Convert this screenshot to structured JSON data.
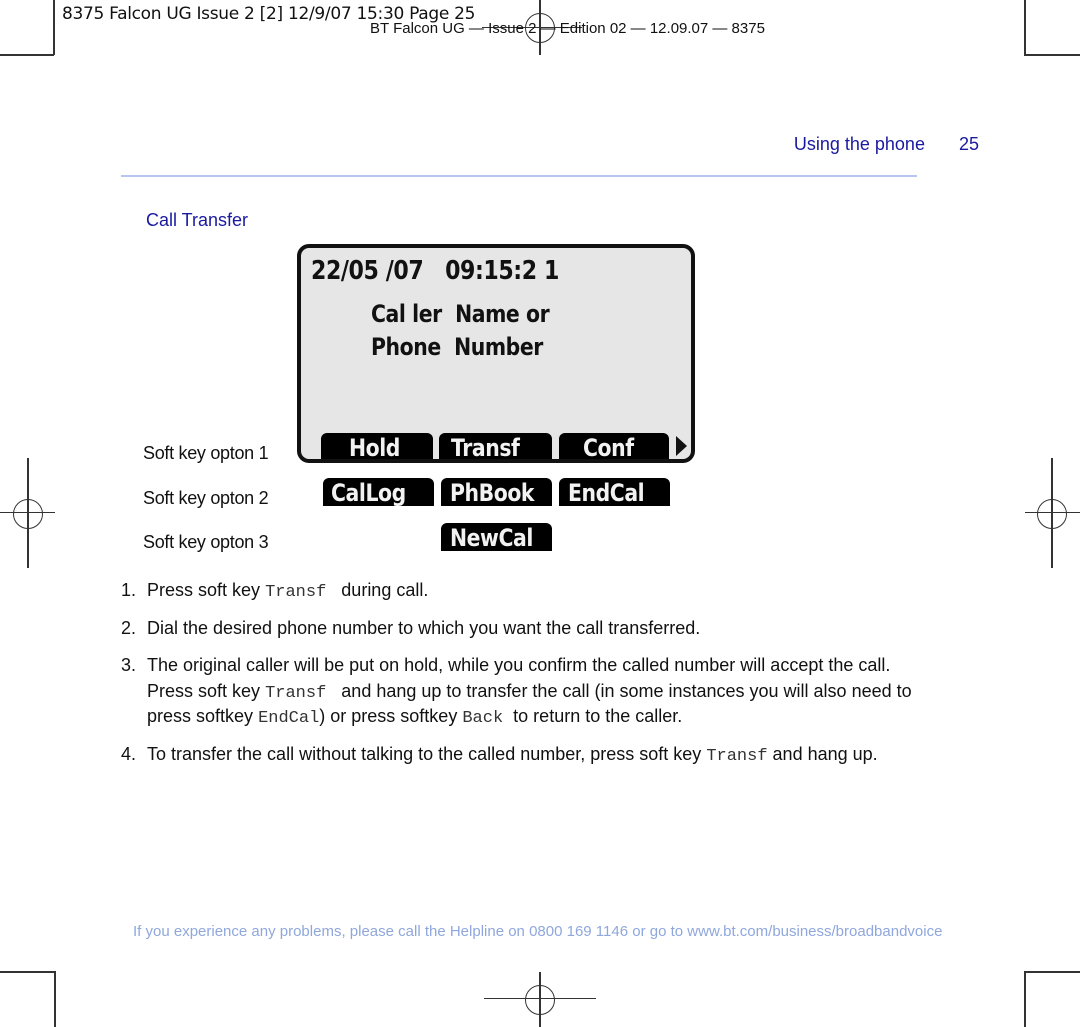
{
  "print_slug": {
    "job_line": "8375 Falcon UG Issue 2 [2]  12/9/07  15:30  Page 25",
    "edition_line": "BT Falcon UG — Issue 2 — Edition 02 — 12.09.07 — 8375"
  },
  "header": {
    "chapter": "Using the phone",
    "page_number": "25"
  },
  "section_title": "Call Transfer",
  "phone_display": {
    "date": "22/05 /07",
    "time": "09:15:2 1",
    "line1": "Cal ler  Name or",
    "line2": "Phone  Number",
    "softkeys_row1": [
      "Hold",
      "Transf",
      "Conf"
    ],
    "more_indicator": "right-arrow-icon"
  },
  "softkey_options": [
    {
      "label": "Soft key opton 1",
      "keys": [
        "Hold",
        "Transf",
        "Conf"
      ]
    },
    {
      "label": "Soft key opton 2",
      "keys": [
        "CalLog",
        "PhBook",
        "EndCal"
      ]
    },
    {
      "label": "Soft key opton 3",
      "keys": [
        "NewCal"
      ]
    }
  ],
  "steps": [
    {
      "num": "1.",
      "parts": [
        "Press soft key",
        "Transf",
        "during call."
      ]
    },
    {
      "num": "2.",
      "text": "Dial the desired phone number to which you want the call transferred."
    },
    {
      "num": "3.",
      "line1": "The original caller will be put on hold, while you confirm the called number will accept the call.",
      "line2_a": "Press soft key",
      "line2_key": "Transf",
      "line2_b": "and hang up to transfer the call (in some instances you will also need to",
      "line3_a": "press softkey",
      "line3_key1": "EndCal",
      "line3_b": ") or press softkey",
      "line3_key2": "Back",
      "line3_c": "to return to the caller."
    },
    {
      "num": "4.",
      "parts": [
        "To transfer the call without talking to the called number, press soft key",
        "Transf",
        "and hang up."
      ]
    }
  ],
  "footer": {
    "text_a": "If you experience any problems, please call the Helpline on",
    "phone": "0800 169 1146",
    "text_b": "or go to",
    "url": "www.bt.com/business/broadbandvoice"
  }
}
